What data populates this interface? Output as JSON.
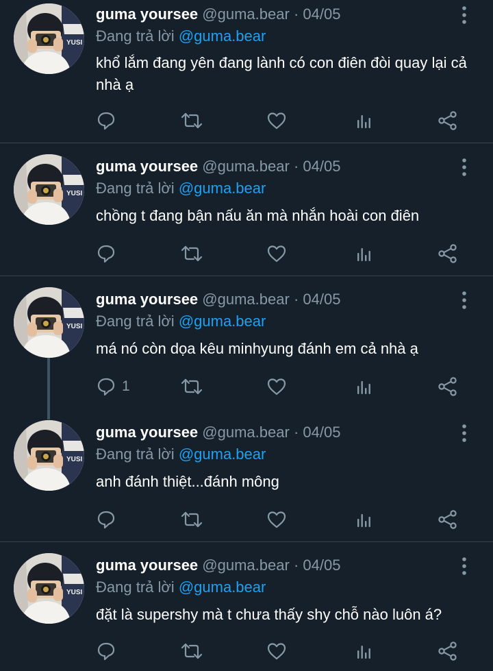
{
  "tweets": [
    {
      "name": "guma yoursee",
      "handle": "@guma.bear",
      "separator": "·",
      "date": "04/05",
      "replying_prefix": "Đang trả lời",
      "replying_to": "@guma.bear",
      "text": "khổ lắm đang yên đang lành có con điên đòi quay lại cả nhà ạ",
      "reply_count": ""
    },
    {
      "name": "guma yoursee",
      "handle": "@guma.bear",
      "separator": "·",
      "date": "04/05",
      "replying_prefix": "Đang trả lời",
      "replying_to": "@guma.bear",
      "text": "chồng t đang bận nấu ăn mà nhắn hoài con điên",
      "reply_count": ""
    },
    {
      "name": "guma yoursee",
      "handle": "@guma.bear",
      "separator": "·",
      "date": "04/05",
      "replying_prefix": "Đang trả lời",
      "replying_to": "@guma.bear",
      "text": "má nó còn dọa kêu minhyung đánh em cả nhà ạ",
      "reply_count": "1"
    },
    {
      "name": "guma yoursee",
      "handle": "@guma.bear",
      "separator": "·",
      "date": "04/05",
      "replying_prefix": "Đang trả lời",
      "replying_to": "@guma.bear",
      "text": "anh đánh thiệt...đánh mông",
      "reply_count": ""
    },
    {
      "name": "guma yoursee",
      "handle": "@guma.bear",
      "separator": "·",
      "date": "04/05",
      "replying_prefix": "Đang trả lời",
      "replying_to": "@guma.bear",
      "text": "đặt là supershy mà t chưa thấy shy chỗ nào luôn á?",
      "reply_count": ""
    }
  ],
  "avatar_overlay_text": "YUSI",
  "icons": {
    "reply": "reply-icon",
    "retweet": "retweet-icon",
    "like": "heart-icon",
    "views": "analytics-icon",
    "share": "share-icon",
    "more": "more-vertical-icon"
  },
  "colors": {
    "background": "#15202b",
    "divider": "#38444d",
    "muted": "#8899a6",
    "link": "#1da1f2",
    "thread_line": "#3d5466"
  }
}
